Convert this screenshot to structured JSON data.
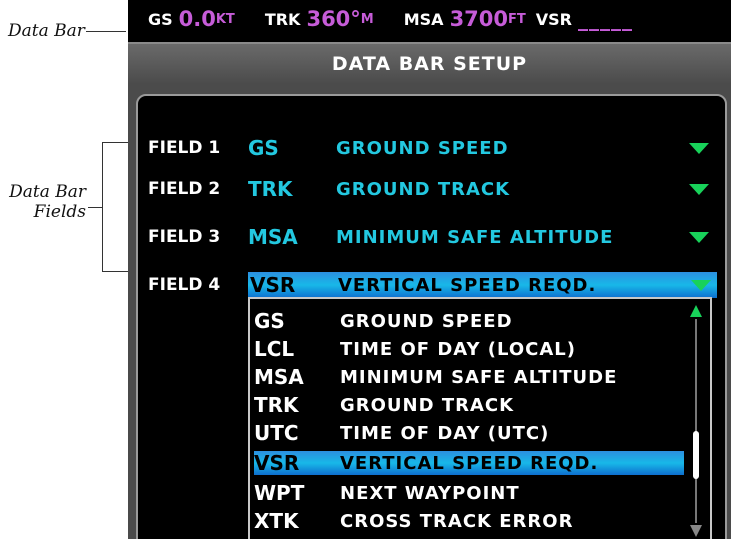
{
  "callouts": {
    "data_bar": "Data Bar",
    "data_bar_fields_line1": "Data Bar",
    "data_bar_fields_line2": "Fields"
  },
  "data_bar": {
    "gs_label": "GS",
    "gs_value": "0.0",
    "gs_unit": "KT",
    "trk_label": "TRK",
    "trk_value": "360°",
    "trk_unit": "M",
    "msa_label": "MSA",
    "msa_value": "3700",
    "msa_unit": "FT",
    "vsr_label": "VSR",
    "vsr_value": "_____"
  },
  "window": {
    "title": "DATA BAR SETUP"
  },
  "fields": [
    {
      "label": "FIELD 1",
      "abbr": "GS",
      "name": "GROUND SPEED"
    },
    {
      "label": "FIELD 2",
      "abbr": "TRK",
      "name": "GROUND TRACK"
    },
    {
      "label": "FIELD 3",
      "abbr": "MSA",
      "name": "MINIMUM SAFE ALTITUDE"
    },
    {
      "label": "FIELD 4",
      "abbr": "VSR",
      "name": "VERTICAL SPEED REQD."
    }
  ],
  "options": [
    {
      "abbr": "GS",
      "name": "GROUND SPEED"
    },
    {
      "abbr": "LCL",
      "name": "TIME OF DAY (LOCAL)"
    },
    {
      "abbr": "MSA",
      "name": "MINIMUM SAFE ALTITUDE"
    },
    {
      "abbr": "TRK",
      "name": "GROUND TRACK"
    },
    {
      "abbr": "UTC",
      "name": "TIME OF DAY (UTC)"
    },
    {
      "abbr": "VSR",
      "name": "VERTICAL SPEED REQD."
    },
    {
      "abbr": "WPT",
      "name": "NEXT WAYPOINT"
    },
    {
      "abbr": "XTK",
      "name": "CROSS TRACK ERROR"
    }
  ],
  "selected_option_index": 5,
  "colors": {
    "value_magenta": "#c65cd8",
    "field_cyan": "#23c8e0",
    "highlight_blue": "#18b8e8",
    "arrow_green": "#18d25a"
  }
}
